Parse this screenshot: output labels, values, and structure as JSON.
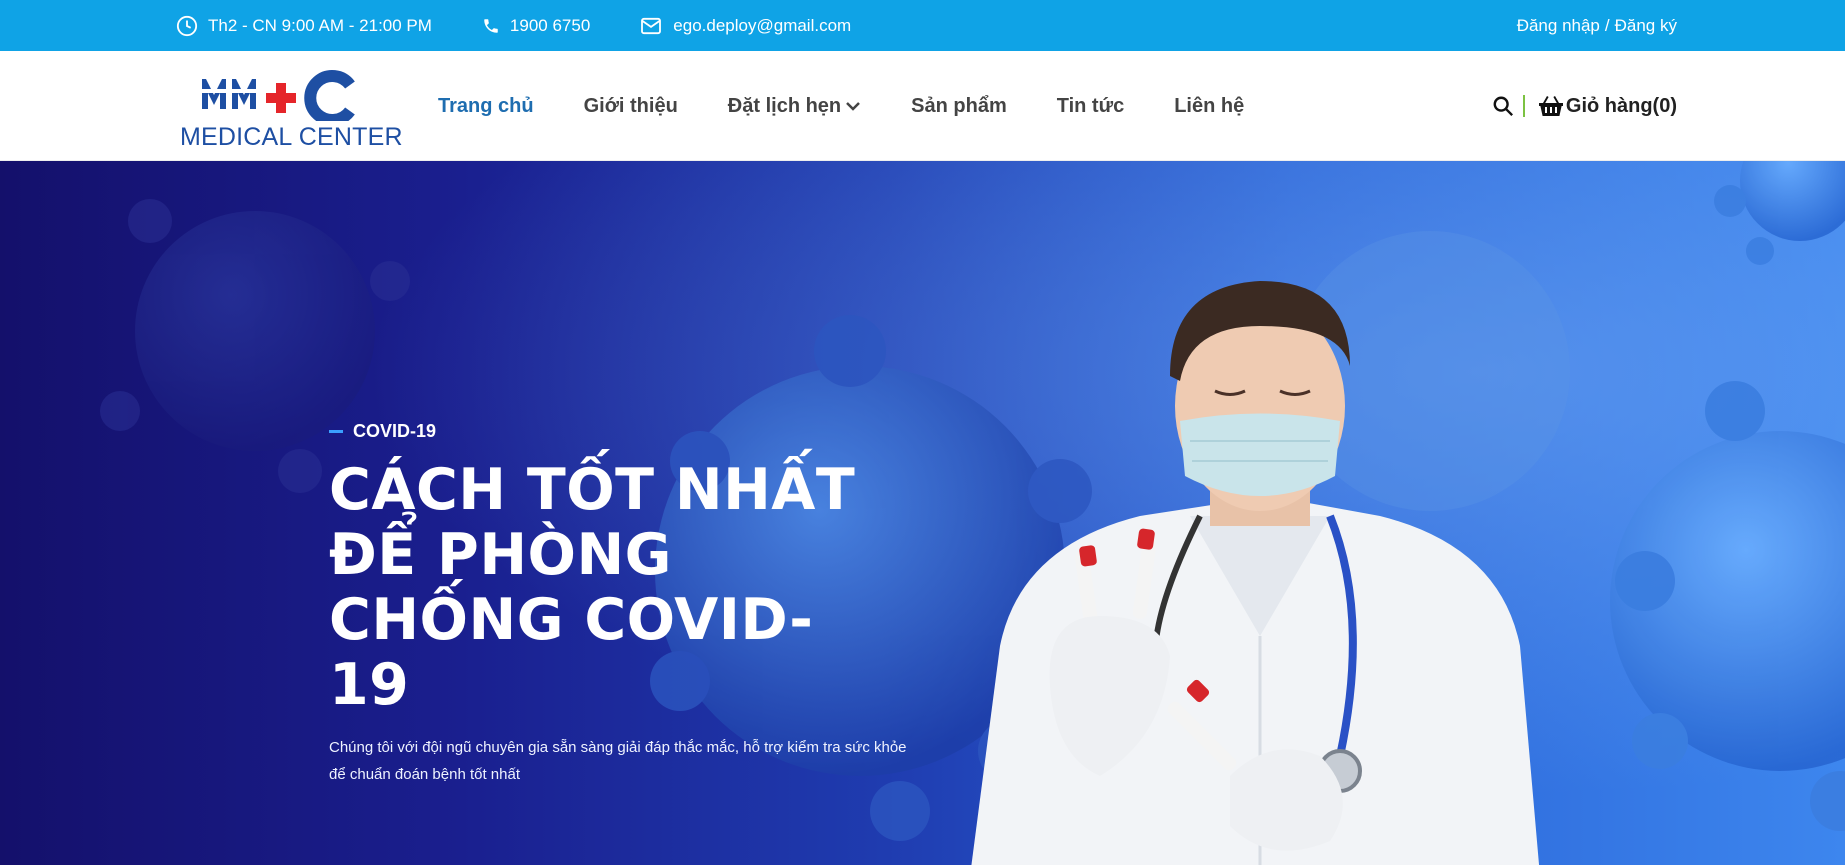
{
  "topbar": {
    "hours": "Th2 - CN 9:00 AM - 21:00 PM",
    "phone": "1900 6750",
    "email": "ego.deploy@gmail.com",
    "login": "Đăng nhập",
    "separator": "/",
    "register": "Đăng ký",
    "hours_icon": "clock-icon",
    "phone_icon": "phone-icon",
    "email_icon": "envelope-icon"
  },
  "logo": {
    "mark": "MMC",
    "text": "MEDICAL CENTER"
  },
  "nav": {
    "items": [
      {
        "label": "Trang chủ",
        "active": true
      },
      {
        "label": "Giới thiệu"
      },
      {
        "label": "Đặt lịch hẹn",
        "has_dropdown": true
      },
      {
        "label": "Sản phẩm"
      },
      {
        "label": "Tin tức"
      },
      {
        "label": "Liên hệ"
      }
    ]
  },
  "header": {
    "cart_label": "Giỏ hàng(0)",
    "search_icon": "search-icon",
    "cart_icon": "basket-icon"
  },
  "hero": {
    "tag": "COVID-19",
    "title": "CÁCH TỐT NHẤT ĐỂ PHÒNG CHỐNG COVID-19",
    "description": "Chúng tôi với đội ngũ chuyên gia sẵn sàng giải đáp thắc mắc, hỗ trợ kiểm tra sức khỏe để chuẩn đoán bệnh tốt nhất"
  },
  "colors": {
    "topbar": "#0fa3e6",
    "nav_active": "#1e6db0",
    "logo_blue": "#1e4fa3",
    "logo_red": "#e5252a",
    "hero_dark": "#14106b",
    "hero_light": "#3d86ee"
  }
}
